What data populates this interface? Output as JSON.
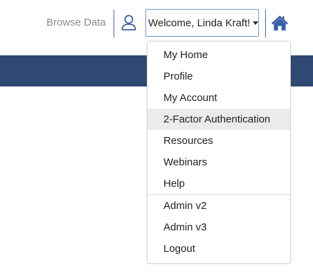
{
  "header": {
    "browse_link": "Browse Data",
    "user_icon": "user-outline-icon",
    "welcome_label": "Welcome, Linda Kraft!",
    "caret_icon": "caret-down-icon",
    "home_icon": "home-icon"
  },
  "colors": {
    "nav_band": "#2f4a72",
    "divider": "#3b6aa8",
    "icon_blue": "#3a5fa8",
    "hover_row": "#e9ebed"
  },
  "dropdown": {
    "highlighted_item": "2-Factor Authentication",
    "group_one": [
      {
        "label": "My Home"
      },
      {
        "label": "Profile"
      },
      {
        "label": "My Account"
      },
      {
        "label": "2-Factor Authentication"
      },
      {
        "label": "Resources"
      },
      {
        "label": "Webinars"
      },
      {
        "label": "Help"
      }
    ],
    "group_two": [
      {
        "label": "Admin v2"
      },
      {
        "label": "Admin v3"
      },
      {
        "label": "Logout"
      }
    ]
  }
}
